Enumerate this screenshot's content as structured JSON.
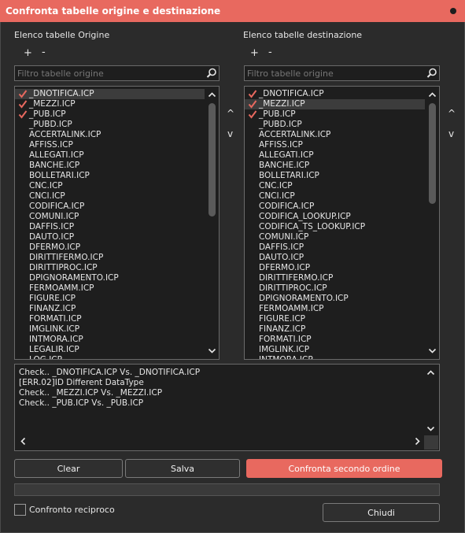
{
  "window": {
    "title": "Confronta tabelle origine e destinazione"
  },
  "source": {
    "label": "Elenco tabelle Origine",
    "add": "+",
    "remove": "-",
    "filter_placeholder": "Filtro tabelle origine",
    "move_up": "^",
    "move_down": "v",
    "items": [
      {
        "name": "_DNOTIFICA.ICP",
        "checked": true
      },
      {
        "name": "_MEZZI.ICP",
        "checked": true
      },
      {
        "name": "_PUB.ICP",
        "checked": true
      },
      {
        "name": "_PUBD.ICP",
        "checked": false
      },
      {
        "name": "ACCERTALINK.ICP",
        "checked": false
      },
      {
        "name": "AFFISS.ICP",
        "checked": false
      },
      {
        "name": "ALLEGATI.ICP",
        "checked": false
      },
      {
        "name": "BANCHE.ICP",
        "checked": false
      },
      {
        "name": "BOLLETARI.ICP",
        "checked": false
      },
      {
        "name": "CNC.ICP",
        "checked": false
      },
      {
        "name": "CNCI.ICP",
        "checked": false
      },
      {
        "name": "CODIFICA.ICP",
        "checked": false
      },
      {
        "name": "COMUNI.ICP",
        "checked": false
      },
      {
        "name": "DAFFIS.ICP",
        "checked": false
      },
      {
        "name": "DAUTO.ICP",
        "checked": false
      },
      {
        "name": "DFERMO.ICP",
        "checked": false
      },
      {
        "name": "DIRITTIFERMO.ICP",
        "checked": false
      },
      {
        "name": "DIRITTIPROC.ICP",
        "checked": false
      },
      {
        "name": "DPIGNORAMENTO.ICP",
        "checked": false
      },
      {
        "name": "FERMOAMM.ICP",
        "checked": false
      },
      {
        "name": "FIGURE.ICP",
        "checked": false
      },
      {
        "name": "FINANZ.ICP",
        "checked": false
      },
      {
        "name": "FORMATI.ICP",
        "checked": false
      },
      {
        "name": "IMGLINK.ICP",
        "checked": false
      },
      {
        "name": "INTMORA.ICP",
        "checked": false
      },
      {
        "name": "LEGALIR.ICP",
        "checked": false
      },
      {
        "name": "LOG.ICP",
        "checked": false
      }
    ]
  },
  "dest": {
    "label": "Elenco tabelle destinazione",
    "add": "+",
    "remove": "-",
    "filter_placeholder": "Filtro tabelle origine",
    "move_up": "^",
    "move_down": "v",
    "items": [
      {
        "name": "_DNOTIFICA.ICP",
        "checked": true
      },
      {
        "name": "_MEZZI.ICP",
        "checked": true
      },
      {
        "name": "_PUB.ICP",
        "checked": true
      },
      {
        "name": "_PUBD.ICP",
        "checked": false
      },
      {
        "name": "ACCERTALINK.ICP",
        "checked": false
      },
      {
        "name": "AFFISS.ICP",
        "checked": false
      },
      {
        "name": "ALLEGATI.ICP",
        "checked": false
      },
      {
        "name": "BANCHE.ICP",
        "checked": false
      },
      {
        "name": "BOLLETARI.ICP",
        "checked": false
      },
      {
        "name": "CNC.ICP",
        "checked": false
      },
      {
        "name": "CNCI.ICP",
        "checked": false
      },
      {
        "name": "CODIFICA.ICP",
        "checked": false
      },
      {
        "name": "CODIFICA_LOOKUP.ICP",
        "checked": false
      },
      {
        "name": "CODIFICA_TS_LOOKUP.ICP",
        "checked": false
      },
      {
        "name": "COMUNI.ICP",
        "checked": false
      },
      {
        "name": "DAFFIS.ICP",
        "checked": false
      },
      {
        "name": "DAUTO.ICP",
        "checked": false
      },
      {
        "name": "DFERMO.ICP",
        "checked": false
      },
      {
        "name": "DIRITTIFERMO.ICP",
        "checked": false
      },
      {
        "name": "DIRITTIPROC.ICP",
        "checked": false
      },
      {
        "name": "DPIGNORAMENTO.ICP",
        "checked": false
      },
      {
        "name": "FERMOAMM.ICP",
        "checked": false
      },
      {
        "name": "FIGURE.ICP",
        "checked": false
      },
      {
        "name": "FINANZ.ICP",
        "checked": false
      },
      {
        "name": "FORMATI.ICP",
        "checked": false
      },
      {
        "name": "IMGLINK.ICP",
        "checked": false
      },
      {
        "name": "INTMORA.ICP",
        "checked": false
      }
    ]
  },
  "log": {
    "lines": [
      "Check.. _DNOTIFICA.ICP Vs. _DNOTIFICA.ICP",
      "[ERR.02]ID Different DataType",
      "Check.. _MEZZI.ICP Vs. _MEZZI.ICP",
      "Check.. _PUB.ICP Vs. _PUB.ICP"
    ]
  },
  "buttons": {
    "clear": "Clear",
    "save": "Salva",
    "compare": "Confronta secondo ordine",
    "close": "Chiudi"
  },
  "options": {
    "reciprocal_label": "Confronto reciproco",
    "reciprocal_checked": false
  },
  "colors": {
    "accent": "#e8695f",
    "background": "#2b2b2b",
    "field": "#1e1e1e",
    "check": "#e8695f"
  }
}
